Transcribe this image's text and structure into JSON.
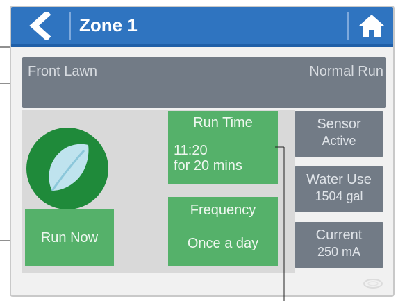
{
  "header": {
    "title": "Zone 1"
  },
  "zone": {
    "name": "Front Lawn",
    "mode": "Normal Run"
  },
  "buttons": {
    "run_now": "Run Now"
  },
  "run_time": {
    "label": "Run Time",
    "time": "11:20",
    "duration": "for 20 mins"
  },
  "frequency": {
    "label": "Frequency",
    "value": "Once a day"
  },
  "status": {
    "sensor_label": "Sensor",
    "sensor_value": "Active",
    "water_use_label": "Water Use",
    "water_use_value": "1504 gal",
    "current_label": "Current",
    "current_value": "250 mA"
  },
  "icons": {
    "back": "chevron-left-icon",
    "home": "home-icon",
    "leaf": "leaf-icon"
  },
  "colors": {
    "header_blue": "#2f74c0",
    "panel_gray": "#727b86",
    "green_button": "#55b16a",
    "leaf_circle": "#1f8a3a"
  }
}
